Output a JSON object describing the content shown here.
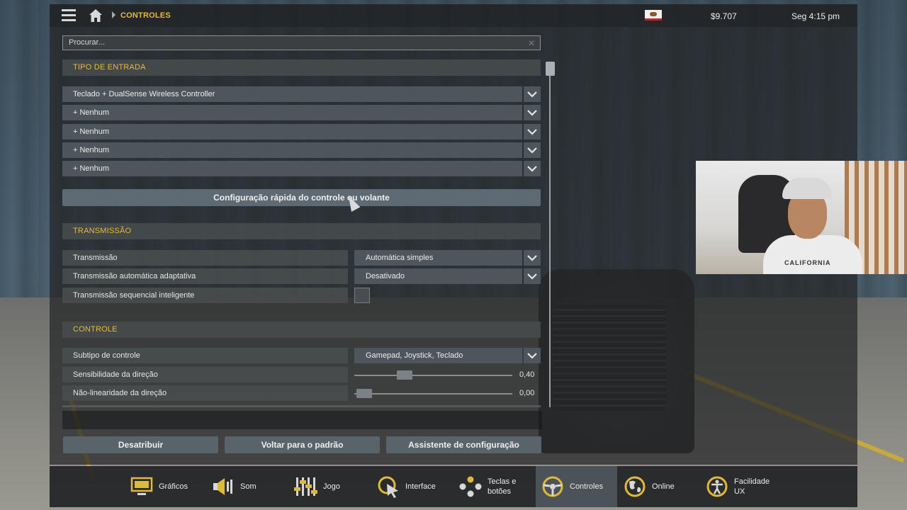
{
  "topbar": {
    "breadcrumb": "CONTROLES",
    "money": "$9.707",
    "clock": "Seg 4:15 pm"
  },
  "search": {
    "placeholder": "Procurar..."
  },
  "sections": {
    "input_type": "TIPO DE ENTRADA",
    "transmission": "TRANSMISSÃO",
    "control": "CONTROLE"
  },
  "input_devices": [
    "Teclado + DualSense Wireless Controller",
    "+ Nenhum",
    "+ Nenhum",
    "+ Nenhum",
    "+ Nenhum"
  ],
  "quick_setup_label": "Configuração rápida do controle ou volante",
  "transmission": {
    "rows": [
      {
        "label": "Transmissão",
        "value": "Automática simples"
      },
      {
        "label": "Transmissão automática adaptativa",
        "value": "Desativado"
      },
      {
        "label": "Transmissão sequencial inteligente",
        "checked": false
      }
    ]
  },
  "control": {
    "rows": [
      {
        "label": "Subtipo de controle",
        "value": "Gamepad, Joystick, Teclado"
      },
      {
        "label": "Sensibilidade da direção",
        "slider": 0.4,
        "display": "0,40"
      },
      {
        "label": "Não-linearidade da direção",
        "slider": 0.0,
        "display": "0,00"
      }
    ]
  },
  "actions": {
    "unassign": "Desatribuir",
    "reset": "Voltar para o padrão",
    "wizard": "Assistente de configuração"
  },
  "nav": [
    {
      "label": "Gráficos",
      "icon": "monitor-icon"
    },
    {
      "label": "Som",
      "icon": "speaker-icon"
    },
    {
      "label": "Jogo",
      "icon": "sliders-icon"
    },
    {
      "label": "Interface",
      "icon": "pointer-icon"
    },
    {
      "label": "Teclas e botões",
      "label_line1": "Teclas e",
      "label_line2": "botões",
      "icon": "buttons-icon"
    },
    {
      "label": "Controles",
      "icon": "steering-wheel-icon",
      "active": true
    },
    {
      "label": "Online",
      "icon": "globe-icon"
    },
    {
      "label": "Facilidade UX",
      "label_line1": "Facilidade",
      "label_line2": "UX",
      "icon": "accessibility-icon"
    }
  ],
  "webcam": {
    "shirt_text": "CALIFORNIA"
  },
  "colors": {
    "accent": "#e8b93a",
    "panel": "#222426",
    "dropdown": "#4d565c"
  }
}
